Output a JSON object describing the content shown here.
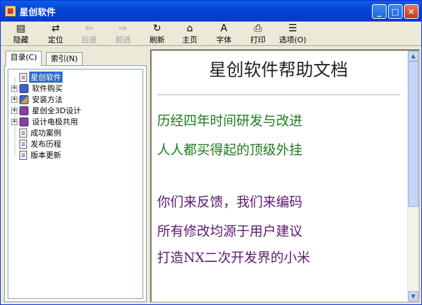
{
  "window": {
    "title": "星创软件"
  },
  "toolbar": {
    "buttons": [
      {
        "label": "隐藏",
        "icon": "hide-icon",
        "glyph": "▤"
      },
      {
        "label": "定位",
        "icon": "locate-icon",
        "glyph": "⇄"
      },
      {
        "label": "后退",
        "icon": "back-arrow-icon",
        "glyph": "⇦"
      },
      {
        "label": "前进",
        "icon": "forward-arrow-icon",
        "glyph": "⇨"
      },
      {
        "label": "刷新",
        "icon": "refresh-icon",
        "glyph": "↻"
      },
      {
        "label": "主页",
        "icon": "home-icon",
        "glyph": "⌂"
      },
      {
        "label": "字体",
        "icon": "font-icon",
        "glyph": "A"
      },
      {
        "label": "打印",
        "icon": "print-icon",
        "glyph": "⎙"
      },
      {
        "label": "选项(O)",
        "icon": "options-icon",
        "glyph": "☰"
      }
    ]
  },
  "tabs": {
    "contents": "目录(C)",
    "index": "索引(N)"
  },
  "tree": {
    "items": [
      {
        "label": "星创软件",
        "type": "page",
        "expander": "",
        "selected": true
      },
      {
        "label": "软件购买",
        "type": "book-blue",
        "expander": "+"
      },
      {
        "label": "安装方法",
        "type": "book-mixed",
        "expander": "+"
      },
      {
        "label": "星创全3D设计",
        "type": "book-purple",
        "expander": "+"
      },
      {
        "label": "设计电极共用",
        "type": "book-purple",
        "expander": "+"
      },
      {
        "label": "成功案例",
        "type": "page",
        "expander": ""
      },
      {
        "label": "发布历程",
        "type": "page",
        "expander": ""
      },
      {
        "label": "版本更新",
        "type": "page",
        "expander": ""
      }
    ]
  },
  "content": {
    "title": "星创软件帮助文档",
    "lines": [
      "历经四年时间研发与改进",
      "人人都买得起的顶级外挂",
      "你们来反馈，我们来编码",
      "所有修改均源于用户建议",
      "打造NX二次开发界的小米"
    ],
    "colors": {
      "green": "#1e7b1e",
      "purple": "#5c1a6e"
    }
  }
}
